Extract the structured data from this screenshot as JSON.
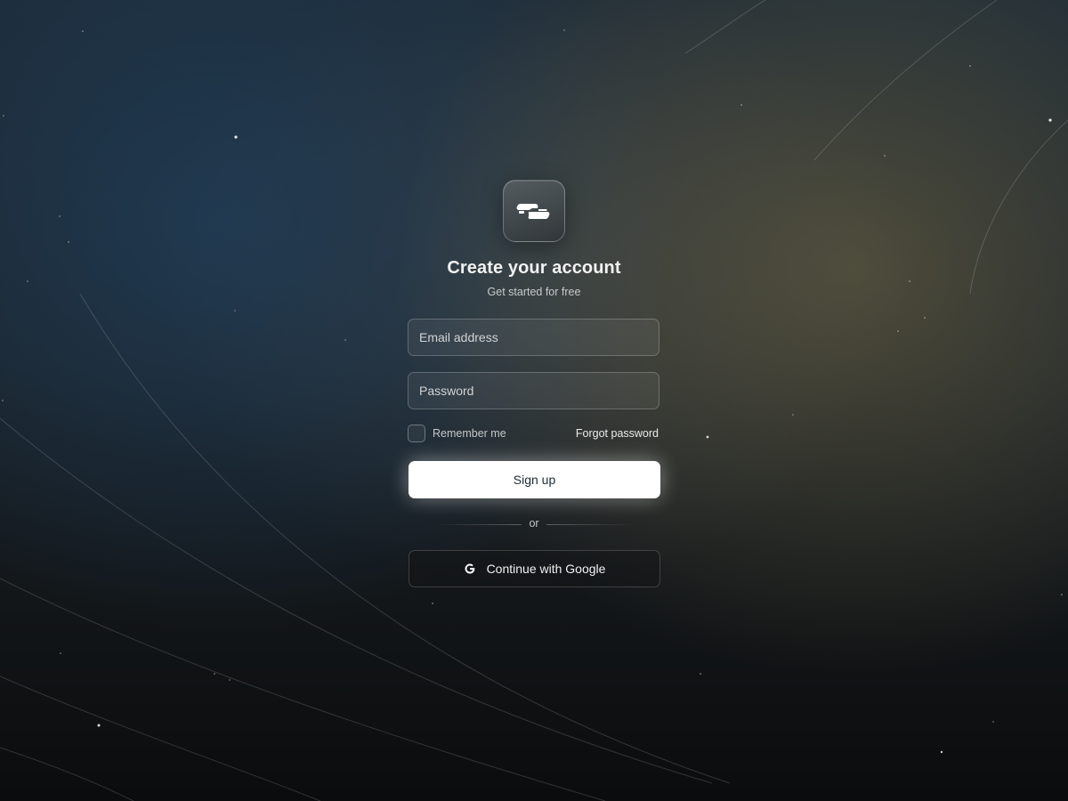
{
  "header": {
    "title": "Create your account",
    "subtitle": "Get started for free"
  },
  "form": {
    "email": {
      "placeholder": "Email address",
      "value": ""
    },
    "password": {
      "placeholder": "Password",
      "value": ""
    },
    "remember_label": "Remember me",
    "remember_checked": false,
    "forgot_label": "Forgot password",
    "submit_label": "Sign up",
    "divider_text": "or",
    "google_label": "Continue with Google"
  },
  "icons": {
    "logo": "brand-logo-icon",
    "google": "google-icon"
  },
  "colors": {
    "accent_button": "#ffffff",
    "button_text": "#1e2a36",
    "text_primary": "#f2f2f2"
  }
}
